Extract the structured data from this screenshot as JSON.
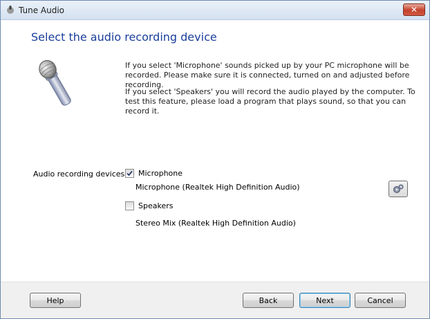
{
  "window": {
    "title": "Tune Audio",
    "close_label": "✕"
  },
  "main": {
    "heading": "Select the audio recording device",
    "paragraph_microphone": "If you select 'Microphone' sounds picked up by your PC microphone will be recorded. Please make sure it is connected, turned on and adjusted before recording.",
    "paragraph_speakers": "If you select 'Speakers' you will record the audio played by the computer. To test this feature, please load a program that plays sound, so that you can record it.",
    "devices_label": "Audio recording devices:",
    "microphone": {
      "label": "Microphone",
      "checked": true,
      "device": "Microphone (Realtek High Definition Audio)"
    },
    "speakers": {
      "label": "Speakers",
      "checked": false,
      "device": "Stereo Mix (Realtek High Definition Audio)"
    }
  },
  "footer": {
    "help_label": "Help",
    "back_label": "Back",
    "next_label": "Next",
    "cancel_label": "Cancel"
  }
}
